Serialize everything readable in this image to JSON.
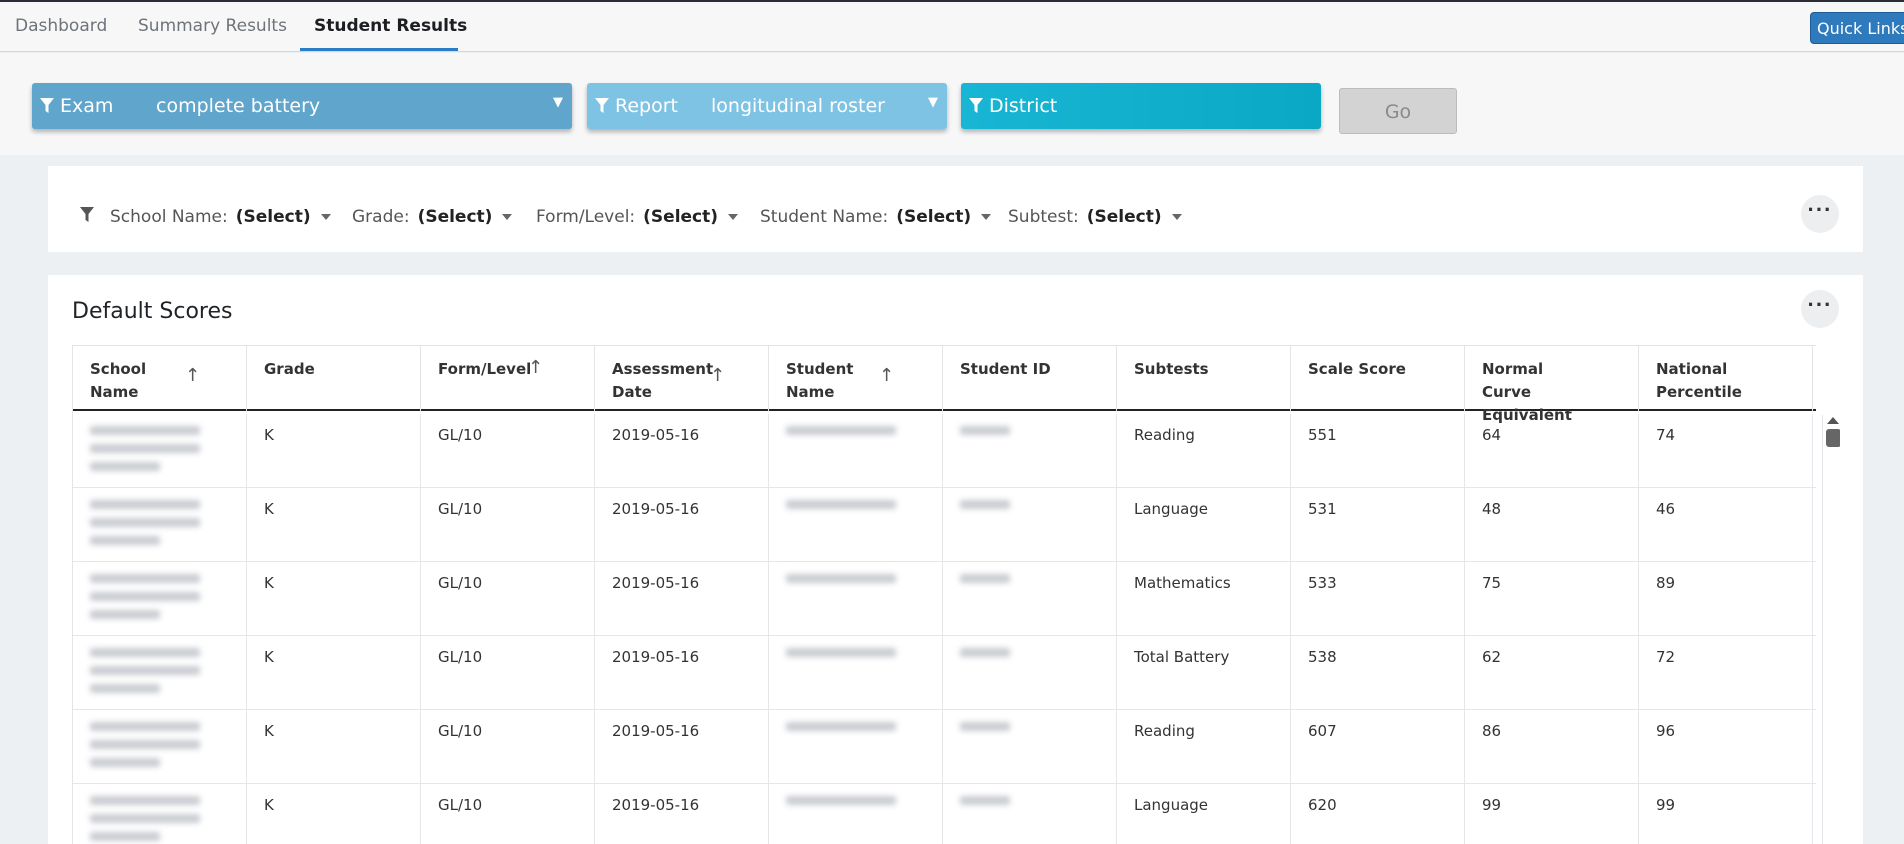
{
  "nav": {
    "tabs": [
      "Dashboard",
      "Summary Results",
      "Student Results"
    ],
    "quick_links": "Quick Links"
  },
  "filters": {
    "exam_label": "Exam",
    "exam_value": "complete battery",
    "report_label": "Report",
    "report_value": "longitudinal roster",
    "district_label": "District",
    "go": "Go"
  },
  "subfilters": [
    {
      "label": "School Name:",
      "value": "(Select)"
    },
    {
      "label": "Grade:",
      "value": "(Select)"
    },
    {
      "label": "Form/Level:",
      "value": "(Select)"
    },
    {
      "label": "Student Name:",
      "value": "(Select)"
    },
    {
      "label": "Subtest:",
      "value": "(Select)"
    }
  ],
  "scores": {
    "title": "Default Scores",
    "columns": [
      "School Name",
      "Grade",
      "Form/Level",
      "Assessment Date",
      "Student Name",
      "Student ID",
      "Subtests",
      "Scale Score",
      "Normal Curve Equivalent",
      "National Percentile"
    ],
    "rows": [
      {
        "grade": "K",
        "form": "GL/10",
        "date": "2019-05-16",
        "subtest": "Reading",
        "scale": "551",
        "nce": "64",
        "np": "74"
      },
      {
        "grade": "K",
        "form": "GL/10",
        "date": "2019-05-16",
        "subtest": "Language",
        "scale": "531",
        "nce": "48",
        "np": "46"
      },
      {
        "grade": "K",
        "form": "GL/10",
        "date": "2019-05-16",
        "subtest": "Mathematics",
        "scale": "533",
        "nce": "75",
        "np": "89"
      },
      {
        "grade": "K",
        "form": "GL/10",
        "date": "2019-05-16",
        "subtest": "Total Battery",
        "scale": "538",
        "nce": "62",
        "np": "72"
      },
      {
        "grade": "K",
        "form": "GL/10",
        "date": "2019-05-16",
        "subtest": "Reading",
        "scale": "607",
        "nce": "86",
        "np": "96"
      },
      {
        "grade": "K",
        "form": "GL/10",
        "date": "2019-05-16",
        "subtest": "Language",
        "scale": "620",
        "nce": "99",
        "np": "99"
      }
    ]
  },
  "colors": {
    "accent": "#2b7cc7",
    "exam": "#5fa5cc",
    "report": "#7ec3e4",
    "district": "#0fb1cf"
  }
}
